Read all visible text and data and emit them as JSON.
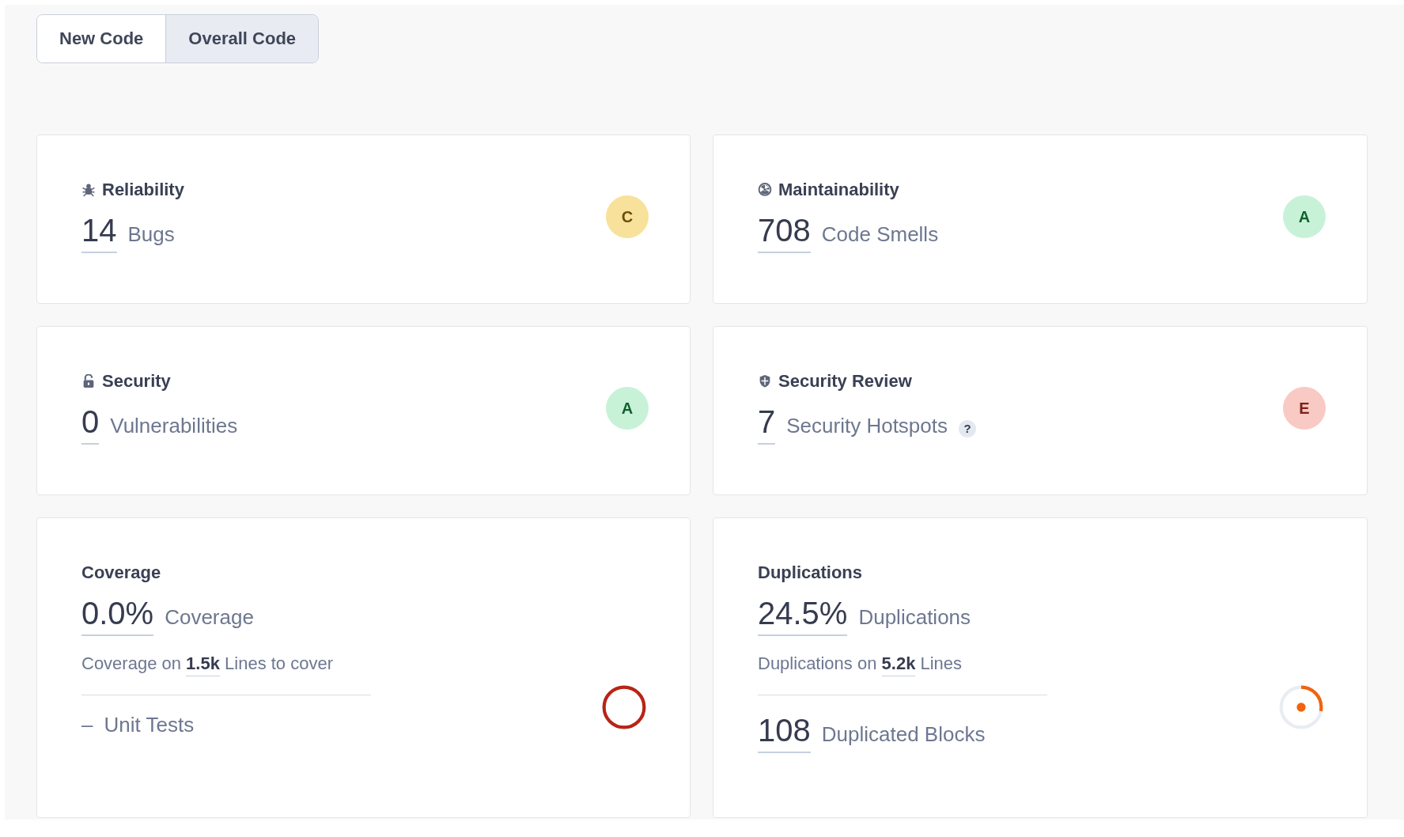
{
  "tabs": [
    {
      "label": "New Code",
      "selected": false
    },
    {
      "label": "Overall Code",
      "selected": true
    }
  ],
  "cards": [
    {
      "kind": "reliability",
      "title": "Reliability",
      "value": "14",
      "unit": "Bugs",
      "rating": "C"
    },
    {
      "kind": "maintainability",
      "title": "Maintainability",
      "value": "708",
      "unit": "Code Smells",
      "rating": "A"
    },
    {
      "kind": "security",
      "title": "Security",
      "value": "0",
      "unit": "Vulnerabilities",
      "rating": "A"
    },
    {
      "kind": "security_review",
      "title": "Security Review",
      "value": "7",
      "unit": "Security Hotspots",
      "help": "?",
      "rating": "E"
    },
    {
      "kind": "coverage",
      "title": "Coverage",
      "value": "0.0%",
      "unit": "Coverage",
      "detail": {
        "prefix": "Coverage on",
        "value": "1.5k",
        "suffix": "Lines to cover"
      },
      "sub": {
        "value": "–",
        "label": "Unit Tests"
      },
      "level": 0
    },
    {
      "kind": "duplications",
      "title": "Duplications",
      "value": "24.5%",
      "unit": "Duplications",
      "detail": {
        "prefix": "Duplications on",
        "value": "5.2k",
        "suffix": "Lines"
      },
      "sub": {
        "value": "108",
        "label": "Duplicated Blocks"
      },
      "level": 0.28
    }
  ]
}
